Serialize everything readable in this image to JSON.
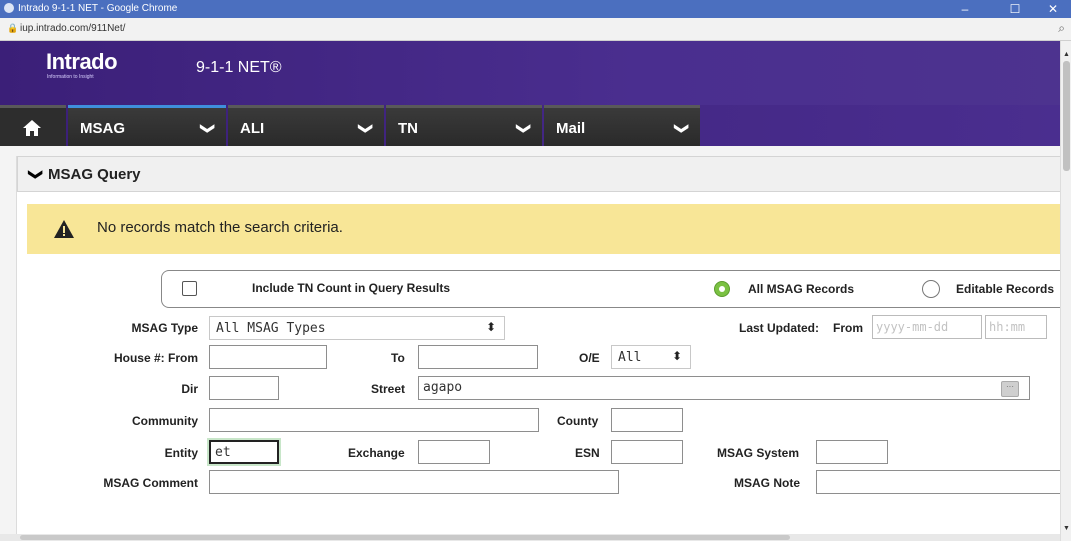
{
  "browser": {
    "title": "Intrado 9-1-1 NET - Google Chrome",
    "url": "iup.intrado.com/911Net/",
    "minimize": "–",
    "maximize": "☐",
    "close": "✕"
  },
  "app": {
    "logo": "Intrado",
    "logo_tagline": "Information to Insight",
    "name": "9-1-1 NET®"
  },
  "nav": {
    "tabs": [
      {
        "label": "MSAG",
        "active": true
      },
      {
        "label": "ALI",
        "active": false
      },
      {
        "label": "TN",
        "active": false
      },
      {
        "label": "Mail",
        "active": false
      }
    ],
    "chevron": "❯"
  },
  "query": {
    "header": "MSAG Query",
    "chevron": "❯"
  },
  "alert": {
    "message": "No records match the search criteria.",
    "color": "#f8e697"
  },
  "options": {
    "include_tn_count_label": "Include TN Count in Query Results",
    "include_tn_count_checked": false,
    "all_records_label": "All MSAG Records",
    "editable_records_label": "Editable Records",
    "selected": "All MSAG Records"
  },
  "form": {
    "msag_type_label": "MSAG Type",
    "msag_type_value": "All MSAG Types",
    "last_updated_label": "Last Updated:",
    "from_label": "From",
    "date_placeholder": "yyyy-mm-dd",
    "time_placeholder": "hh:mm",
    "house_from_label": "House #: From",
    "house_from_value": "",
    "to_label": "To",
    "house_to_value": "",
    "oe_label": "O/E",
    "oe_value": "All",
    "dir_label": "Dir",
    "dir_value": "",
    "street_label": "Street",
    "street_value": "agapo",
    "lookup_glyph": "···",
    "community_label": "Community",
    "community_value": "",
    "county_label": "County",
    "county_value": "",
    "entity_label": "Entity",
    "entity_value": "et",
    "exchange_label": "Exchange",
    "exchange_value": "",
    "esn_label": "ESN",
    "esn_value": "",
    "msag_system_label": "MSAG System",
    "msag_system_value": "",
    "msag_comment_label": "MSAG Comment",
    "msag_comment_value": "",
    "msag_note_label": "MSAG Note",
    "msag_note_value": ""
  },
  "icons": {
    "home": "home-icon",
    "warning": "warning-icon",
    "select_arrow": "⬍"
  },
  "colors": {
    "header_purple": "#3b1f78",
    "active_tab": "#3f8fdc",
    "radio_selected": "#7ac142"
  }
}
